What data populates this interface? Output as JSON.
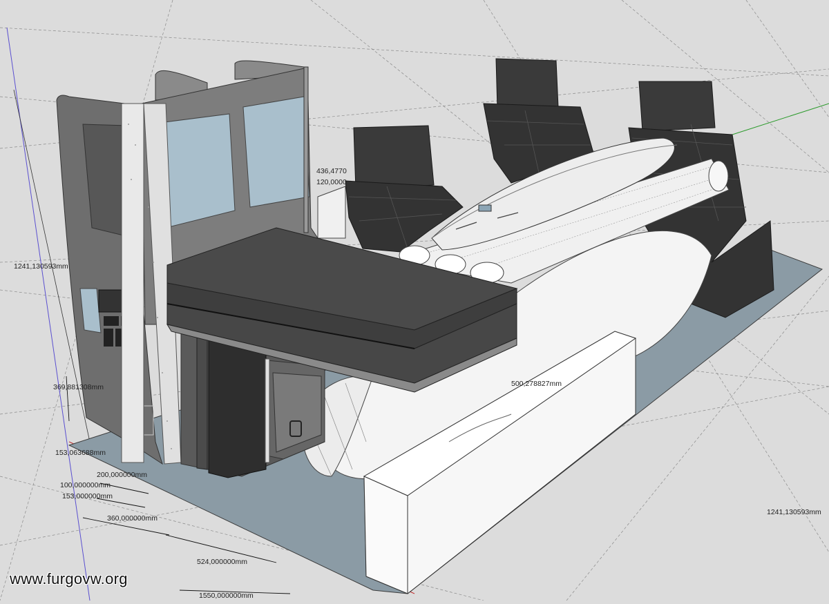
{
  "watermark": "www.furgovw.org",
  "dimensions": {
    "d1": "1241,130593mm",
    "d2": "369,881308mm",
    "d3": "153,063688mm",
    "d4": "200,000000mm",
    "d5": "100,000000mm",
    "d6": "153,000000mm",
    "d7": "360,000000mm",
    "d8": "524,000000mm",
    "d9": "1550,000000mm",
    "d10": "500,278827mm",
    "d11": "1241,130593mm",
    "d12": "436,4770",
    "d13": "120,0000"
  },
  "colors": {
    "background": "#dcdcdc",
    "floor": "#8b9ba5",
    "panel_gray": "#6e6e6e",
    "cushion": "#4a4a4a",
    "seat": "#3b3b3b",
    "white_body": "#f4f4f4",
    "glass": "#a9bfcc"
  }
}
